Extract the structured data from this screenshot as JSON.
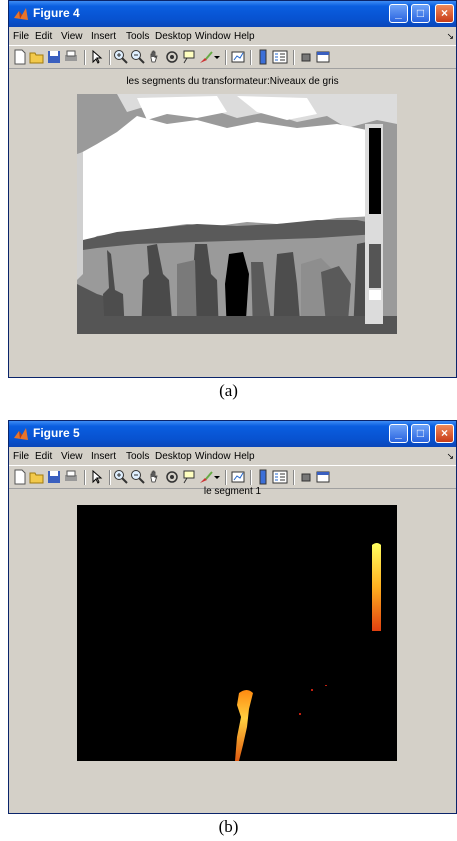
{
  "menu": [
    "File",
    "Edit",
    "View",
    "Insert",
    "Tools",
    "Desktop",
    "Window",
    "Help"
  ],
  "menu_arrow": "↘",
  "window_buttons": {
    "minimize": "_",
    "maximize": "□",
    "close": "×"
  },
  "colors": {
    "titlebar": "#0a5ee0",
    "window_bg": "#d4d0c8",
    "close_button": "#c73c18"
  },
  "figure_a": {
    "title": "Figure 4",
    "plot_title": "les segments du transformateur:Niveaux de gris",
    "caption": "(a)"
  },
  "figure_b": {
    "title": "Figure 5",
    "plot_title": "le segment 1",
    "caption": "(b)"
  },
  "toolbar_icons": [
    "new-file-icon",
    "open-folder-icon",
    "save-icon",
    "print-icon",
    "pointer-icon",
    "zoom-in-icon",
    "zoom-out-icon",
    "pan-hand-icon",
    "rotate-3d-icon",
    "data-cursor-icon",
    "brush-icon",
    "brush-dropdown-icon",
    "link-plot-icon",
    "colorbar-icon",
    "legend-icon",
    "hide-plot-tools-icon",
    "show-plot-tools-icon"
  ]
}
